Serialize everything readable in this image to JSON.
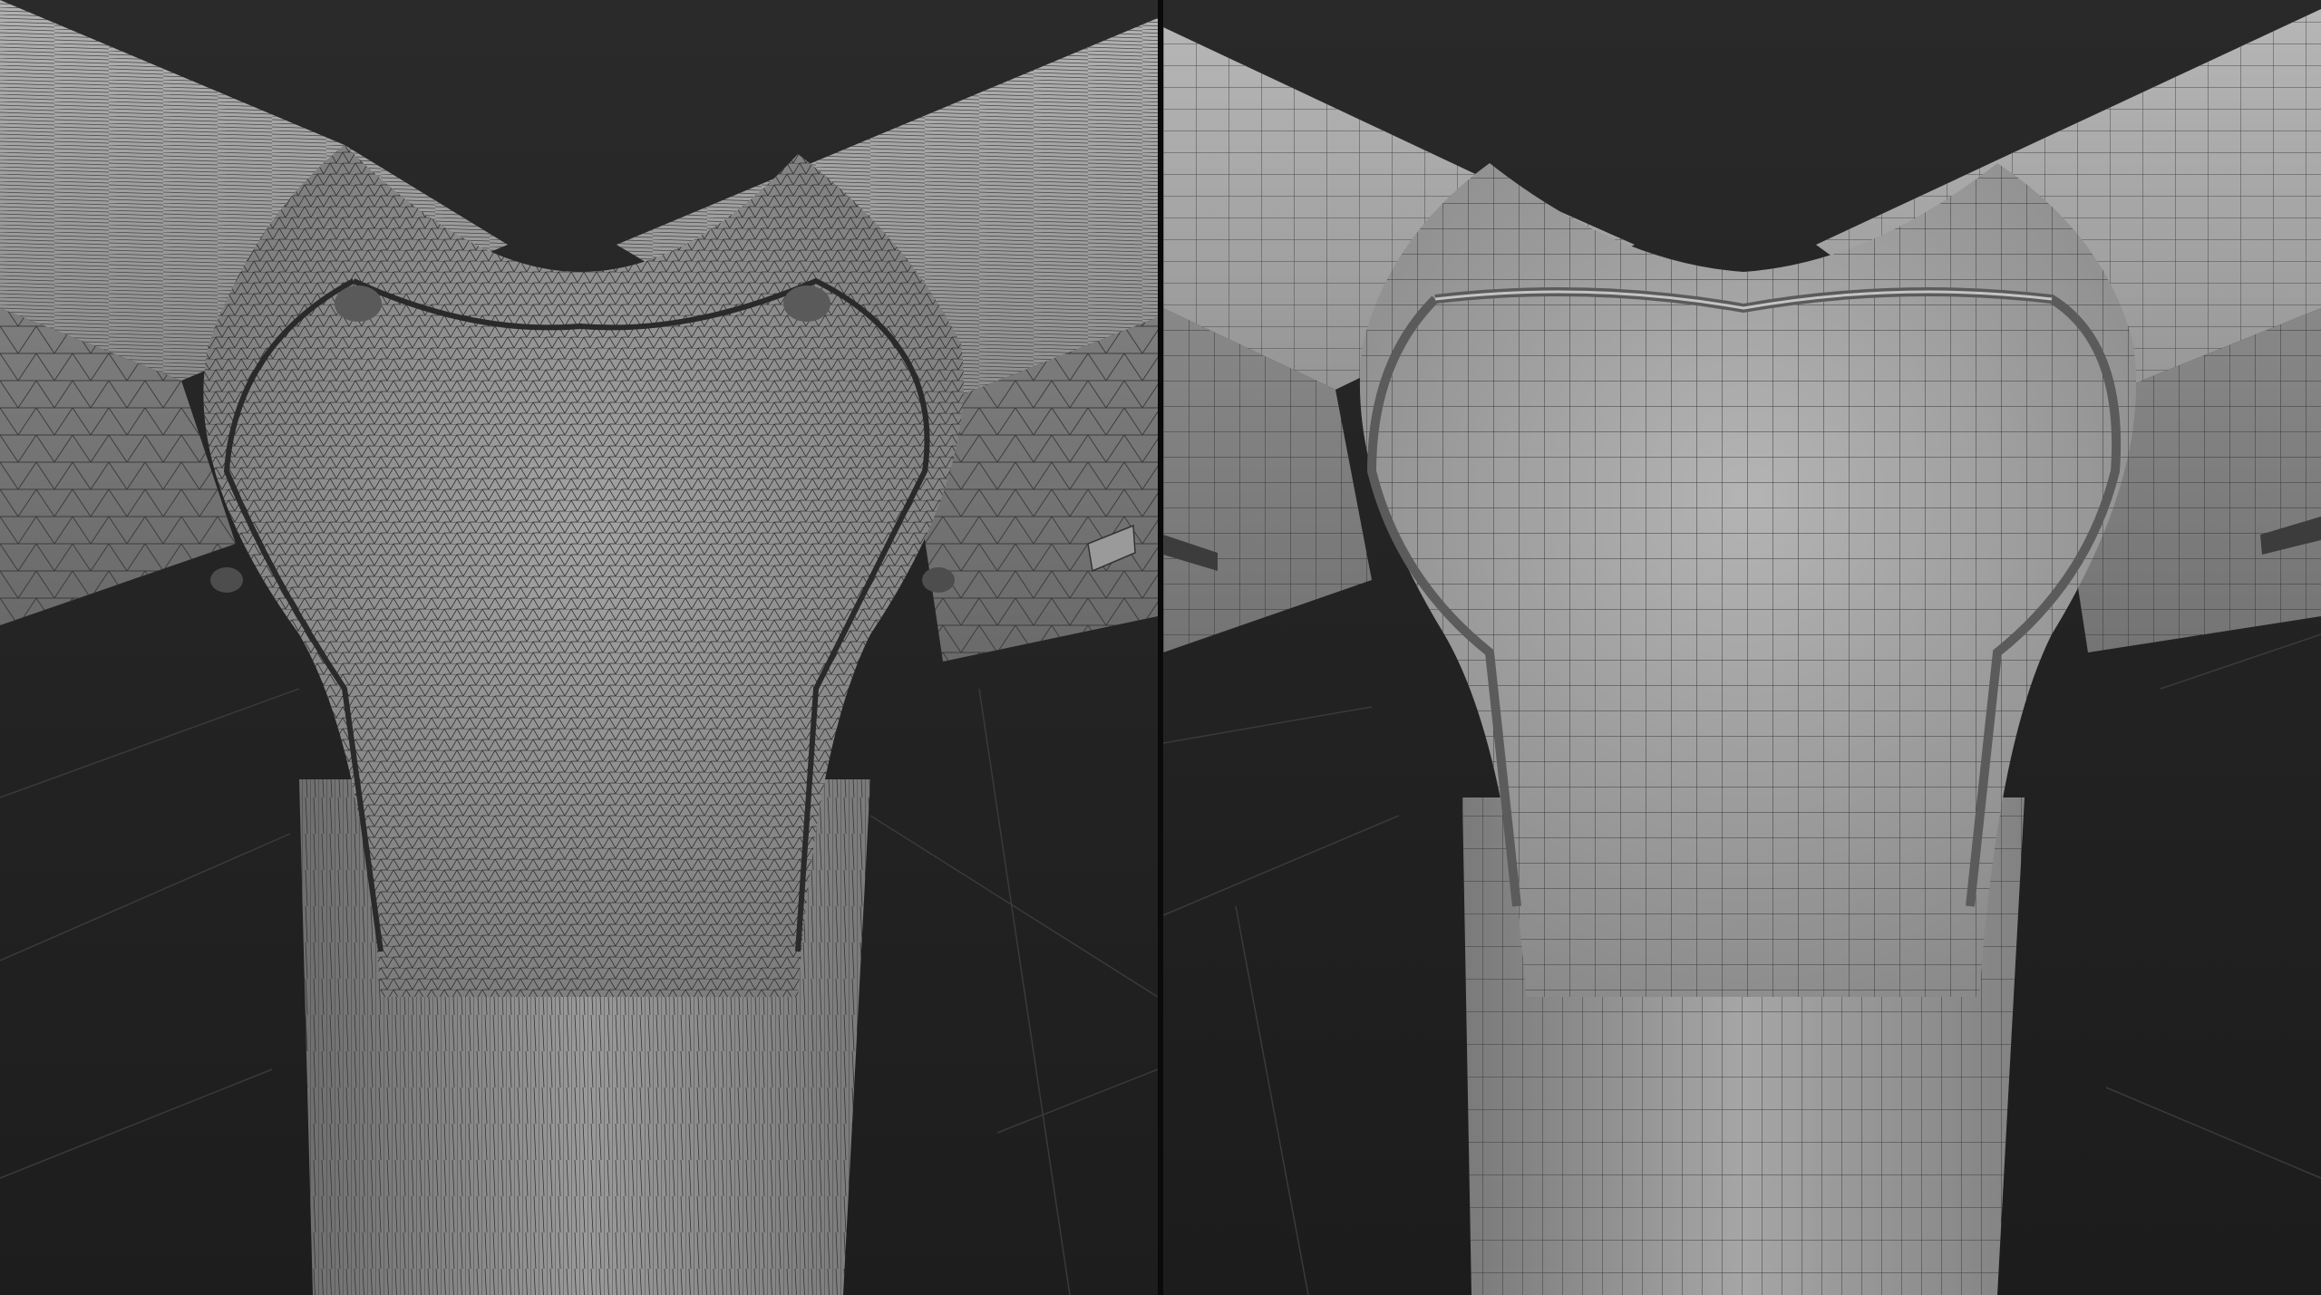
{
  "panels": [
    {
      "name": "triangulated-mesh-view",
      "mesh": "triangles"
    },
    {
      "name": "quad-topology-mesh-view",
      "mesh": "quads"
    }
  ],
  "colors": {
    "background": "#222222",
    "surface": "#8e8e8e",
    "surface_light": "#a8a8a8",
    "wire_dense": "#2a2a2a",
    "wire": "#3a3a3a",
    "divider": "#0a0a0a"
  }
}
